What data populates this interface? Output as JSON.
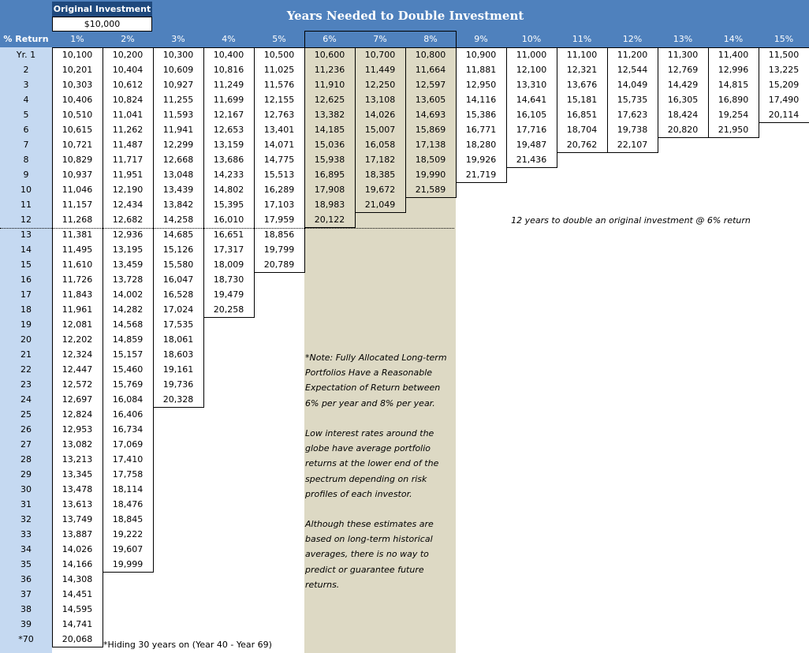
{
  "original_investment": {
    "label": "Original Investment",
    "value": "$10,000"
  },
  "title": "Years Needed to Double Investment",
  "return_header_label": "% Return",
  "column_headers": [
    "1%",
    "2%",
    "3%",
    "4%",
    "5%",
    "6%",
    "7%",
    "8%",
    "9%",
    "10%",
    "11%",
    "12%",
    "13%",
    "14%",
    "15%"
  ],
  "highlight_columns": [
    "6%",
    "7%",
    "8%"
  ],
  "year_labels": [
    "Yr. 1",
    "2",
    "3",
    "4",
    "5",
    "6",
    "7",
    "8",
    "9",
    "10",
    "11",
    "12",
    "13",
    "14",
    "15",
    "16",
    "17",
    "18",
    "19",
    "20",
    "21",
    "22",
    "23",
    "24",
    "25",
    "26",
    "27",
    "28",
    "29",
    "30",
    "31",
    "32",
    "33",
    "34",
    "35",
    "36",
    "37",
    "38",
    "39",
    "*70"
  ],
  "annotation": "12 years to double an original investment @ 6% return",
  "footnote": "*Hiding 30 years on (Year 40 - Year 69)",
  "note_lines": [
    "*Note: Fully Allocated Long-term",
    "Portfolios Have a Reasonable",
    "Expectation of Return between",
    "6% per year and 8% per year.",
    "",
    "Low interest rates around the",
    "globe have average  portfolio",
    "returns at the lower end of the",
    "spectrum depending on risk",
    "profiles of each investor.",
    "",
    "Although these estimates are",
    "based on long-term historical",
    "averages, there is no way to",
    "predict or guarantee future",
    "returns."
  ],
  "chart_data": {
    "type": "table",
    "title": "Years Needed to Double Investment",
    "columns": [
      "1%",
      "2%",
      "3%",
      "4%",
      "5%",
      "6%",
      "7%",
      "8%",
      "9%",
      "10%",
      "11%",
      "12%",
      "13%",
      "14%",
      "15%"
    ],
    "rows": [
      {
        "year": "Yr. 1",
        "values": [
          "10,100",
          "10,200",
          "10,300",
          "10,400",
          "10,500",
          "10,600",
          "10,700",
          "10,800",
          "10,900",
          "11,000",
          "11,100",
          "11,200",
          "11,300",
          "11,400",
          "11,500"
        ]
      },
      {
        "year": "2",
        "values": [
          "10,201",
          "10,404",
          "10,609",
          "10,816",
          "11,025",
          "11,236",
          "11,449",
          "11,664",
          "11,881",
          "12,100",
          "12,321",
          "12,544",
          "12,769",
          "12,996",
          "13,225"
        ]
      },
      {
        "year": "3",
        "values": [
          "10,303",
          "10,612",
          "10,927",
          "11,249",
          "11,576",
          "11,910",
          "12,250",
          "12,597",
          "12,950",
          "13,310",
          "13,676",
          "14,049",
          "14,429",
          "14,815",
          "15,209"
        ]
      },
      {
        "year": "4",
        "values": [
          "10,406",
          "10,824",
          "11,255",
          "11,699",
          "12,155",
          "12,625",
          "13,108",
          "13,605",
          "14,116",
          "14,641",
          "15,181",
          "15,735",
          "16,305",
          "16,890",
          "17,490"
        ]
      },
      {
        "year": "5",
        "values": [
          "10,510",
          "11,041",
          "11,593",
          "12,167",
          "12,763",
          "13,382",
          "14,026",
          "14,693",
          "15,386",
          "16,105",
          "16,851",
          "17,623",
          "18,424",
          "19,254",
          "20,114"
        ]
      },
      {
        "year": "6",
        "values": [
          "10,615",
          "11,262",
          "11,941",
          "12,653",
          "13,401",
          "14,185",
          "15,007",
          "15,869",
          "16,771",
          "17,716",
          "18,704",
          "19,738",
          "20,820",
          "21,950",
          ""
        ]
      },
      {
        "year": "7",
        "values": [
          "10,721",
          "11,487",
          "12,299",
          "13,159",
          "14,071",
          "15,036",
          "16,058",
          "17,138",
          "18,280",
          "19,487",
          "20,762",
          "22,107",
          "",
          "",
          ""
        ]
      },
      {
        "year": "8",
        "values": [
          "10,829",
          "11,717",
          "12,668",
          "13,686",
          "14,775",
          "15,938",
          "17,182",
          "18,509",
          "19,926",
          "21,436",
          "",
          "",
          "",
          "",
          ""
        ]
      },
      {
        "year": "9",
        "values": [
          "10,937",
          "11,951",
          "13,048",
          "14,233",
          "15,513",
          "16,895",
          "18,385",
          "19,990",
          "21,719",
          "",
          "",
          "",
          "",
          "",
          ""
        ]
      },
      {
        "year": "10",
        "values": [
          "11,046",
          "12,190",
          "13,439",
          "14,802",
          "16,289",
          "17,908",
          "19,672",
          "21,589",
          "",
          "",
          "",
          "",
          "",
          "",
          ""
        ]
      },
      {
        "year": "11",
        "values": [
          "11,157",
          "12,434",
          "13,842",
          "15,395",
          "17,103",
          "18,983",
          "21,049",
          "",
          "",
          "",
          "",
          "",
          "",
          "",
          ""
        ]
      },
      {
        "year": "12",
        "values": [
          "11,268",
          "12,682",
          "14,258",
          "16,010",
          "17,959",
          "20,122",
          "",
          "",
          "",
          "",
          "",
          "",
          "",
          "",
          ""
        ]
      },
      {
        "year": "13",
        "values": [
          "11,381",
          "12,936",
          "14,685",
          "16,651",
          "18,856",
          "",
          "",
          "",
          "",
          "",
          "",
          "",
          "",
          "",
          ""
        ]
      },
      {
        "year": "14",
        "values": [
          "11,495",
          "13,195",
          "15,126",
          "17,317",
          "19,799",
          "",
          "",
          "",
          "",
          "",
          "",
          "",
          "",
          "",
          ""
        ]
      },
      {
        "year": "15",
        "values": [
          "11,610",
          "13,459",
          "15,580",
          "18,009",
          "20,789",
          "",
          "",
          "",
          "",
          "",
          "",
          "",
          "",
          "",
          ""
        ]
      },
      {
        "year": "16",
        "values": [
          "11,726",
          "13,728",
          "16,047",
          "18,730",
          "",
          "",
          "",
          "",
          "",
          "",
          "",
          "",
          "",
          "",
          ""
        ]
      },
      {
        "year": "17",
        "values": [
          "11,843",
          "14,002",
          "16,528",
          "19,479",
          "",
          "",
          "",
          "",
          "",
          "",
          "",
          "",
          "",
          "",
          ""
        ]
      },
      {
        "year": "18",
        "values": [
          "11,961",
          "14,282",
          "17,024",
          "20,258",
          "",
          "",
          "",
          "",
          "",
          "",
          "",
          "",
          "",
          "",
          ""
        ]
      },
      {
        "year": "19",
        "values": [
          "12,081",
          "14,568",
          "17,535",
          "",
          "",
          "",
          "",
          "",
          "",
          "",
          "",
          "",
          "",
          "",
          ""
        ]
      },
      {
        "year": "20",
        "values": [
          "12,202",
          "14,859",
          "18,061",
          "",
          "",
          "",
          "",
          "",
          "",
          "",
          "",
          "",
          "",
          "",
          ""
        ]
      },
      {
        "year": "21",
        "values": [
          "12,324",
          "15,157",
          "18,603",
          "",
          "",
          "",
          "",
          "",
          "",
          "",
          "",
          "",
          "",
          "",
          ""
        ]
      },
      {
        "year": "22",
        "values": [
          "12,447",
          "15,460",
          "19,161",
          "",
          "",
          "",
          "",
          "",
          "",
          "",
          "",
          "",
          "",
          "",
          ""
        ]
      },
      {
        "year": "23",
        "values": [
          "12,572",
          "15,769",
          "19,736",
          "",
          "",
          "",
          "",
          "",
          "",
          "",
          "",
          "",
          "",
          "",
          ""
        ]
      },
      {
        "year": "24",
        "values": [
          "12,697",
          "16,084",
          "20,328",
          "",
          "",
          "",
          "",
          "",
          "",
          "",
          "",
          "",
          "",
          "",
          ""
        ]
      },
      {
        "year": "25",
        "values": [
          "12,824",
          "16,406",
          "",
          "",
          "",
          "",
          "",
          "",
          "",
          "",
          "",
          "",
          "",
          "",
          ""
        ]
      },
      {
        "year": "26",
        "values": [
          "12,953",
          "16,734",
          "",
          "",
          "",
          "",
          "",
          "",
          "",
          "",
          "",
          "",
          "",
          "",
          ""
        ]
      },
      {
        "year": "27",
        "values": [
          "13,082",
          "17,069",
          "",
          "",
          "",
          "",
          "",
          "",
          "",
          "",
          "",
          "",
          "",
          "",
          ""
        ]
      },
      {
        "year": "28",
        "values": [
          "13,213",
          "17,410",
          "",
          "",
          "",
          "",
          "",
          "",
          "",
          "",
          "",
          "",
          "",
          "",
          ""
        ]
      },
      {
        "year": "29",
        "values": [
          "13,345",
          "17,758",
          "",
          "",
          "",
          "",
          "",
          "",
          "",
          "",
          "",
          "",
          "",
          "",
          ""
        ]
      },
      {
        "year": "30",
        "values": [
          "13,478",
          "18,114",
          "",
          "",
          "",
          "",
          "",
          "",
          "",
          "",
          "",
          "",
          "",
          "",
          ""
        ]
      },
      {
        "year": "31",
        "values": [
          "13,613",
          "18,476",
          "",
          "",
          "",
          "",
          "",
          "",
          "",
          "",
          "",
          "",
          "",
          "",
          ""
        ]
      },
      {
        "year": "32",
        "values": [
          "13,749",
          "18,845",
          "",
          "",
          "",
          "",
          "",
          "",
          "",
          "",
          "",
          "",
          "",
          "",
          ""
        ]
      },
      {
        "year": "33",
        "values": [
          "13,887",
          "19,222",
          "",
          "",
          "",
          "",
          "",
          "",
          "",
          "",
          "",
          "",
          "",
          "",
          ""
        ]
      },
      {
        "year": "34",
        "values": [
          "14,026",
          "19,607",
          "",
          "",
          "",
          "",
          "",
          "",
          "",
          "",
          "",
          "",
          "",
          "",
          ""
        ]
      },
      {
        "year": "35",
        "values": [
          "14,166",
          "19,999",
          "",
          "",
          "",
          "",
          "",
          "",
          "",
          "",
          "",
          "",
          "",
          "",
          ""
        ]
      },
      {
        "year": "36",
        "values": [
          "14,308",
          "",
          "",
          "",
          "",
          "",
          "",
          "",
          "",
          "",
          "",
          "",
          "",
          "",
          ""
        ]
      },
      {
        "year": "37",
        "values": [
          "14,451",
          "",
          "",
          "",
          "",
          "",
          "",
          "",
          "",
          "",
          "",
          "",
          "",
          "",
          ""
        ]
      },
      {
        "year": "38",
        "values": [
          "14,595",
          "",
          "",
          "",
          "",
          "",
          "",
          "",
          "",
          "",
          "",
          "",
          "",
          "",
          ""
        ]
      },
      {
        "year": "39",
        "values": [
          "14,741",
          "",
          "",
          "",
          "",
          "",
          "",
          "",
          "",
          "",
          "",
          "",
          "",
          "",
          ""
        ]
      },
      {
        "year": "*70",
        "values": [
          "20,068",
          "",
          "",
          "",
          "",
          "",
          "",
          "",
          "",
          "",
          "",
          "",
          "",
          "",
          ""
        ]
      }
    ],
    "doubling_row_index": [
      39,
      34,
      23,
      17,
      14,
      11,
      10,
      9,
      8,
      7,
      6,
      6,
      5,
      5,
      4
    ],
    "colors": {
      "header": "#4F81BD",
      "header_dark": "#1F497D",
      "year_column": "#C5D9F1",
      "highlight": "#DDD9C4"
    }
  }
}
